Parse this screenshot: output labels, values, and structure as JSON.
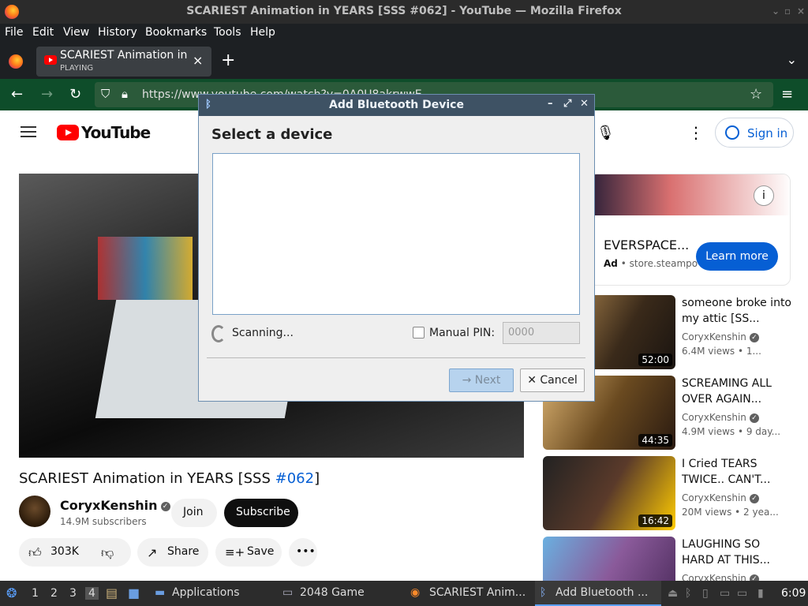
{
  "window": {
    "title": "SCARIEST Animation in YEARS [SSS #062] - YouTube — Mozilla Firefox"
  },
  "menu": {
    "file": "File",
    "edit": "Edit",
    "view": "View",
    "history": "History",
    "bookmarks": "Bookmarks",
    "tools": "Tools",
    "help": "Help"
  },
  "tab": {
    "title": "SCARIEST Animation in Y",
    "status": "PLAYING"
  },
  "address": {
    "url": "https://www.youtube.com/watch?v=0A0U8akrwwE"
  },
  "youtube": {
    "logo_text": "YouTube",
    "sign_in": "Sign in",
    "video_title_prefix": "SCARIEST Animation in YEARS [SSS ",
    "video_title_hash": "#062",
    "video_title_suffix": "]",
    "channel": "CoryxKenshin",
    "subscribers": "14.9M subscribers",
    "join": "Join",
    "subscribe": "Subscribe",
    "likes": "303K",
    "share": "Share",
    "save": "Save",
    "ad": {
      "name": "EVERSPACE...",
      "label": "Ad",
      "domain": "store.steampo",
      "button": "Learn more"
    },
    "recs": [
      {
        "title": "someone broke into my attic [SS...",
        "channel": "CoryxKenshin",
        "views": "6.4M views  •  1...",
        "duration": "52:00"
      },
      {
        "title": "SCREAMING ALL OVER AGAIN...",
        "channel": "CoryxKenshin",
        "views": "4.9M views  •  9 day...",
        "duration": "44:35"
      },
      {
        "title": "I Cried TEARS TWICE.. CAN'T...",
        "channel": "CoryxKenshin",
        "views": "20M views  •  2 yea...",
        "duration": "16:42"
      },
      {
        "title": "LAUGHING SO HARD AT THIS...",
        "channel": "CoryxKenshin",
        "views": "",
        "duration": ""
      }
    ]
  },
  "dialog": {
    "title": "Add Bluetooth Device",
    "heading": "Select a device",
    "scanning": "Scanning...",
    "manual_pin_label": "Manual PIN:",
    "pin_placeholder": "0000",
    "next": "Next",
    "cancel": "Cancel"
  },
  "taskbar": {
    "workspaces": [
      "1",
      "2",
      "3",
      "4"
    ],
    "apps_label": "Applications",
    "game": "2048 Game",
    "firefox": "SCARIEST Anim...",
    "bluetooth": "Add Bluetooth ...",
    "clock": "6:09"
  },
  "colors": {
    "accent": "#065fd4",
    "nav_bg": "#0e4d2a",
    "yt_red": "#ff0000"
  }
}
